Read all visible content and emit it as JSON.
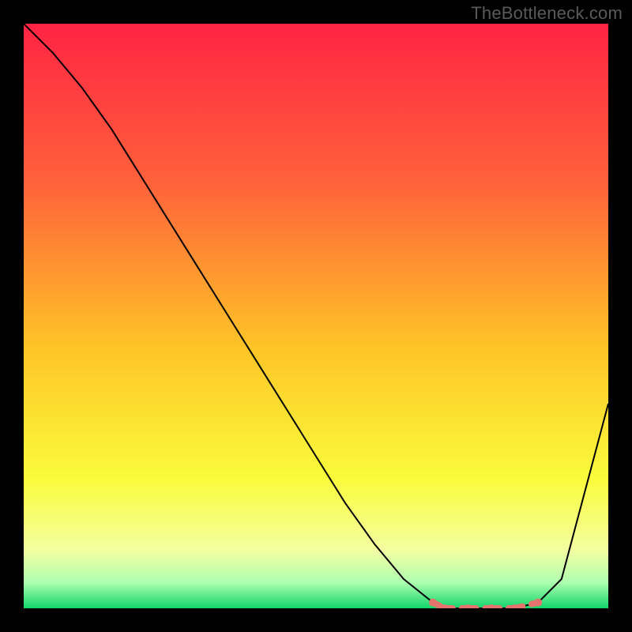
{
  "watermark": "TheBottleneck.com",
  "chart_data": {
    "type": "line",
    "title": "",
    "xlabel": "",
    "ylabel": "",
    "xlim": [
      0,
      100
    ],
    "ylim": [
      0,
      100
    ],
    "grid": false,
    "series": [
      {
        "name": "bottleneck-curve",
        "x": [
          0,
          5,
          10,
          15,
          20,
          25,
          30,
          35,
          40,
          45,
          50,
          55,
          60,
          65,
          70,
          72,
          76,
          80,
          84,
          88,
          92,
          100
        ],
        "y": [
          100,
          95,
          89,
          82,
          74,
          66,
          58,
          50,
          42,
          34,
          26,
          18,
          11,
          5,
          1,
          0,
          0,
          0,
          0,
          1,
          5,
          35
        ],
        "color": "#000000"
      }
    ],
    "highlight": {
      "name": "optimal-zone",
      "color": "#e5736e",
      "x": [
        70,
        72,
        76,
        80,
        84,
        88
      ],
      "y": [
        1,
        0,
        0,
        0,
        0,
        1
      ]
    },
    "background_gradient": {
      "stops": [
        {
          "offset": 0.0,
          "color": "#ff2343"
        },
        {
          "offset": 0.28,
          "color": "#ff643b"
        },
        {
          "offset": 0.55,
          "color": "#ffc326"
        },
        {
          "offset": 0.78,
          "color": "#fafc3c"
        },
        {
          "offset": 0.9,
          "color": "#f3ffa0"
        },
        {
          "offset": 0.955,
          "color": "#b1ffb1"
        },
        {
          "offset": 1.0,
          "color": "#12d66a"
        }
      ]
    }
  }
}
